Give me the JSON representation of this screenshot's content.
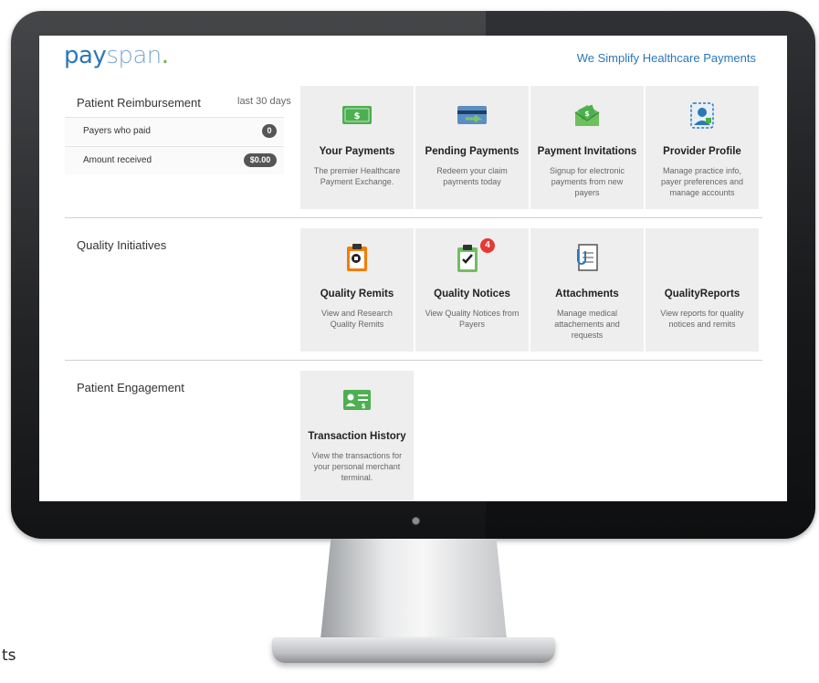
{
  "stray_text": "ts",
  "brand": {
    "logo_pay": "pay",
    "logo_span": "span",
    "logo_dot": ".",
    "tagline": "We Simplify Healthcare Payments"
  },
  "reimbursement": {
    "title": "Patient Reimbursement",
    "period": "last 30 days",
    "metrics": [
      {
        "label": "Payers who paid",
        "value": "0"
      },
      {
        "label": "Amount received",
        "value": "$0.00"
      }
    ],
    "tiles": [
      {
        "icon": "money-icon",
        "title": "Your Payments",
        "desc": "The premier Healthcare Payment Exchange."
      },
      {
        "icon": "credit-card-icon",
        "title": "Pending Payments",
        "desc": "Redeem your claim payments today"
      },
      {
        "icon": "money-envelope-icon",
        "title": "Payment Invitations",
        "desc": "Signup for electronic payments from new payers"
      },
      {
        "icon": "provider-badge-icon",
        "title": "Provider Profile",
        "desc": "Manage practice info, payer preferences and manage accounts"
      }
    ]
  },
  "quality": {
    "title": "Quality Initiatives",
    "tiles": [
      {
        "icon": "medical-clipboard-icon",
        "title": "Quality Remits",
        "desc": "View and Research Quality Remits"
      },
      {
        "icon": "checklist-clipboard-icon",
        "title": "Quality Notices",
        "desc": "View Quality Notices from Payers",
        "badge": "4"
      },
      {
        "icon": "paperclip-document-icon",
        "title": "Attachments",
        "desc": "Manage medical attachements and requests"
      },
      {
        "icon": "report-icon",
        "title": "QualityReports",
        "desc": "View reports for quality notices and remits"
      }
    ]
  },
  "engagement": {
    "title": "Patient Engagement",
    "tiles": [
      {
        "icon": "id-card-money-icon",
        "title": "Transaction History",
        "desc": "View the transactions for your personal merchant terminal."
      }
    ]
  },
  "colors": {
    "brand_blue": "#2b78b7",
    "tile_bg": "#eeeeee",
    "green": "#4caf50",
    "badge_red": "#e53935"
  }
}
